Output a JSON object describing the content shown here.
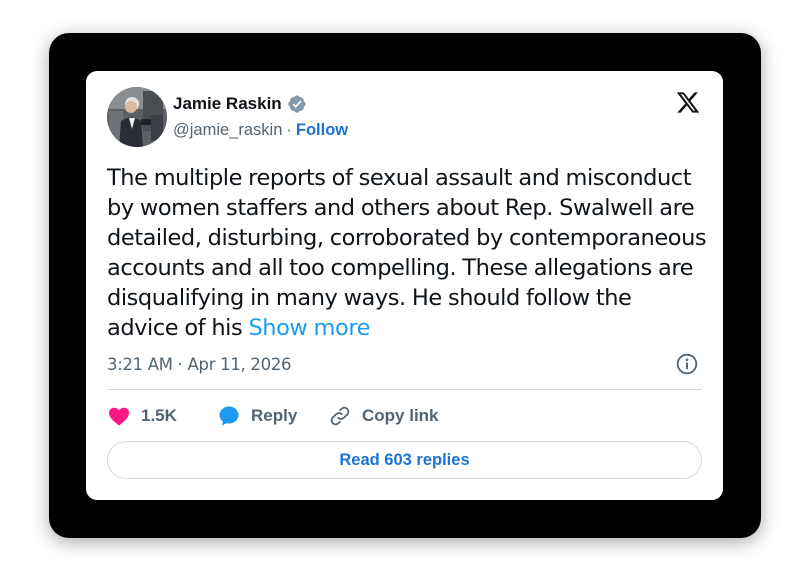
{
  "author": {
    "name": "Jamie Raskin",
    "handle": "@jamie_raskin",
    "separator": "·",
    "follow_label": "Follow"
  },
  "icons": {
    "verified": "verified-badge-icon",
    "brand": "x-logo-icon",
    "info": "info-icon",
    "like": "heart-icon",
    "reply": "speech-bubble-icon",
    "copy": "link-icon"
  },
  "tweet": {
    "text": "The multiple reports of sexual assault and misconduct by women staffers and others about Rep. Swalwell are detailed, disturbing, corroborated by contemporaneous accounts and all too compelling. These allegations are disqualifying in many ways. He should follow the advice of his ",
    "show_more": "Show more",
    "timestamp": "3:21 AM · Apr 11, 2026"
  },
  "actions": {
    "likes": "1.5K",
    "reply_label": "Reply",
    "copy_link_label": "Copy link"
  },
  "read_replies_label": "Read 603 replies",
  "colors": {
    "text_primary": "#0f1419",
    "text_secondary": "#536471",
    "link": "#1d9bf0",
    "follow": "#1d74d8",
    "like": "#f91880",
    "reply": "#1d9bf0",
    "verified": "#829aab",
    "frame": "#000000",
    "divider": "#cfd9de"
  }
}
